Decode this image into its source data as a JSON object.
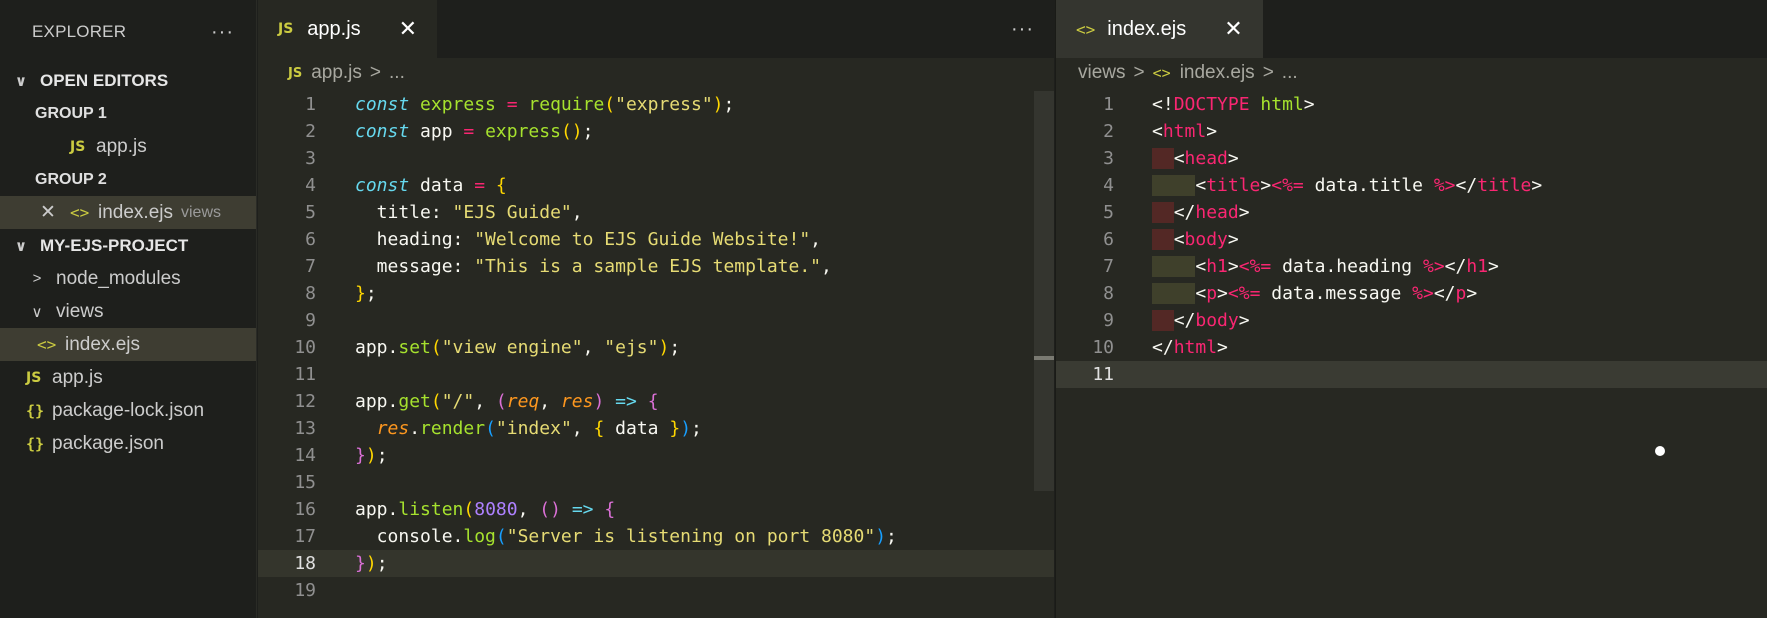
{
  "sidebar": {
    "title": "EXPLORER",
    "more": "···",
    "open_editors": {
      "label": "OPEN EDITORS",
      "group1": {
        "label": "GROUP 1",
        "file": "app.js"
      },
      "group2": {
        "label": "GROUP 2",
        "file": "index.ejs",
        "folder": "views"
      }
    },
    "project": {
      "label": "MY-EJS-PROJECT",
      "items": [
        "node_modules",
        "views",
        "index.ejs",
        "app.js",
        "package-lock.json",
        "package.json"
      ]
    }
  },
  "editor_left": {
    "tab": "app.js",
    "breadcrumb": {
      "file": "app.js",
      "rest": "..."
    },
    "more": "···",
    "current_line": 18
  },
  "editor_right": {
    "tab": "index.ejs",
    "breadcrumb": {
      "folder": "views",
      "file": "index.ejs",
      "rest": "..."
    },
    "current_line": 11
  },
  "icons": {
    "js": "JS",
    "ejs": "<>",
    "json": "{}",
    "close": "✕",
    "chevron_down": "∨",
    "chevron_right": ">"
  },
  "colors": {
    "background": "#272822",
    "sidebar": "#1e1f1c",
    "selection": "#3e3d32",
    "keyword": "#66d9ef",
    "string": "#e6db74",
    "tag": "#f92672",
    "icon": "#cbcb41"
  }
}
